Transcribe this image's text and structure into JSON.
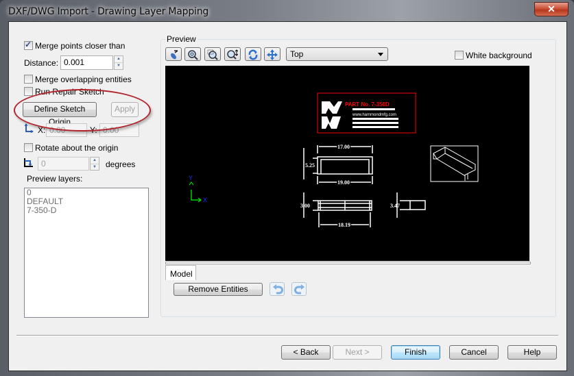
{
  "window": {
    "title": "DXF/DWG Import - Drawing Layer Mapping",
    "close_icon": "close-icon"
  },
  "options": {
    "merge_points_label": "Merge points closer than",
    "merge_points_checked": true,
    "distance_label": "Distance:",
    "distance_value": "0.001",
    "merge_overlapping_label": "Merge overlapping entities",
    "merge_overlapping_checked": false,
    "run_repair_label": "Run Repair Sketch",
    "run_repair_checked": false,
    "define_origin_label": "Define Sketch Origin",
    "apply_label": "Apply",
    "x_label": "X:",
    "x_value": "0.00",
    "y_label": "Y:",
    "y_value": "0.00",
    "rotate_label": "Rotate about the origin",
    "rotate_checked": false,
    "degrees_value": "0",
    "degrees_label": "degrees",
    "preview_layers_label": "Preview layers:",
    "layers": [
      "0",
      "DEFAULT",
      "7-350-D"
    ]
  },
  "preview": {
    "group_label": "Preview",
    "toolbar_icons": [
      "zoom-to-fit-icon",
      "zoom-in-icon",
      "zoom-window-icon",
      "zoom-in-out-icon",
      "rotate-icon",
      "pan-icon"
    ],
    "view_selected": "Top",
    "white_background_label": "White background",
    "white_background_checked": false,
    "drawing": {
      "title_block_text": "PART No. 7-350D",
      "url_text": "www.hammondmfg.com",
      "dims": [
        "17.00",
        "5.25",
        "19.00",
        "3.00",
        "18.19",
        "3.47"
      ],
      "axis_x": "X",
      "axis_y": "Y"
    },
    "tab_model": "Model",
    "remove_entities_label": "Remove Entities"
  },
  "footer": {
    "back_label": "< Back",
    "next_label": "Next >",
    "finish_label": "Finish",
    "cancel_label": "Cancel",
    "help_label": "Help"
  },
  "colors": {
    "annotation_ellipse": "#b0232a",
    "viewport_bg": "#000000",
    "title_block_red": "#ff0000",
    "axis_green": "#00ff00",
    "axis_blue": "#2030ff"
  }
}
